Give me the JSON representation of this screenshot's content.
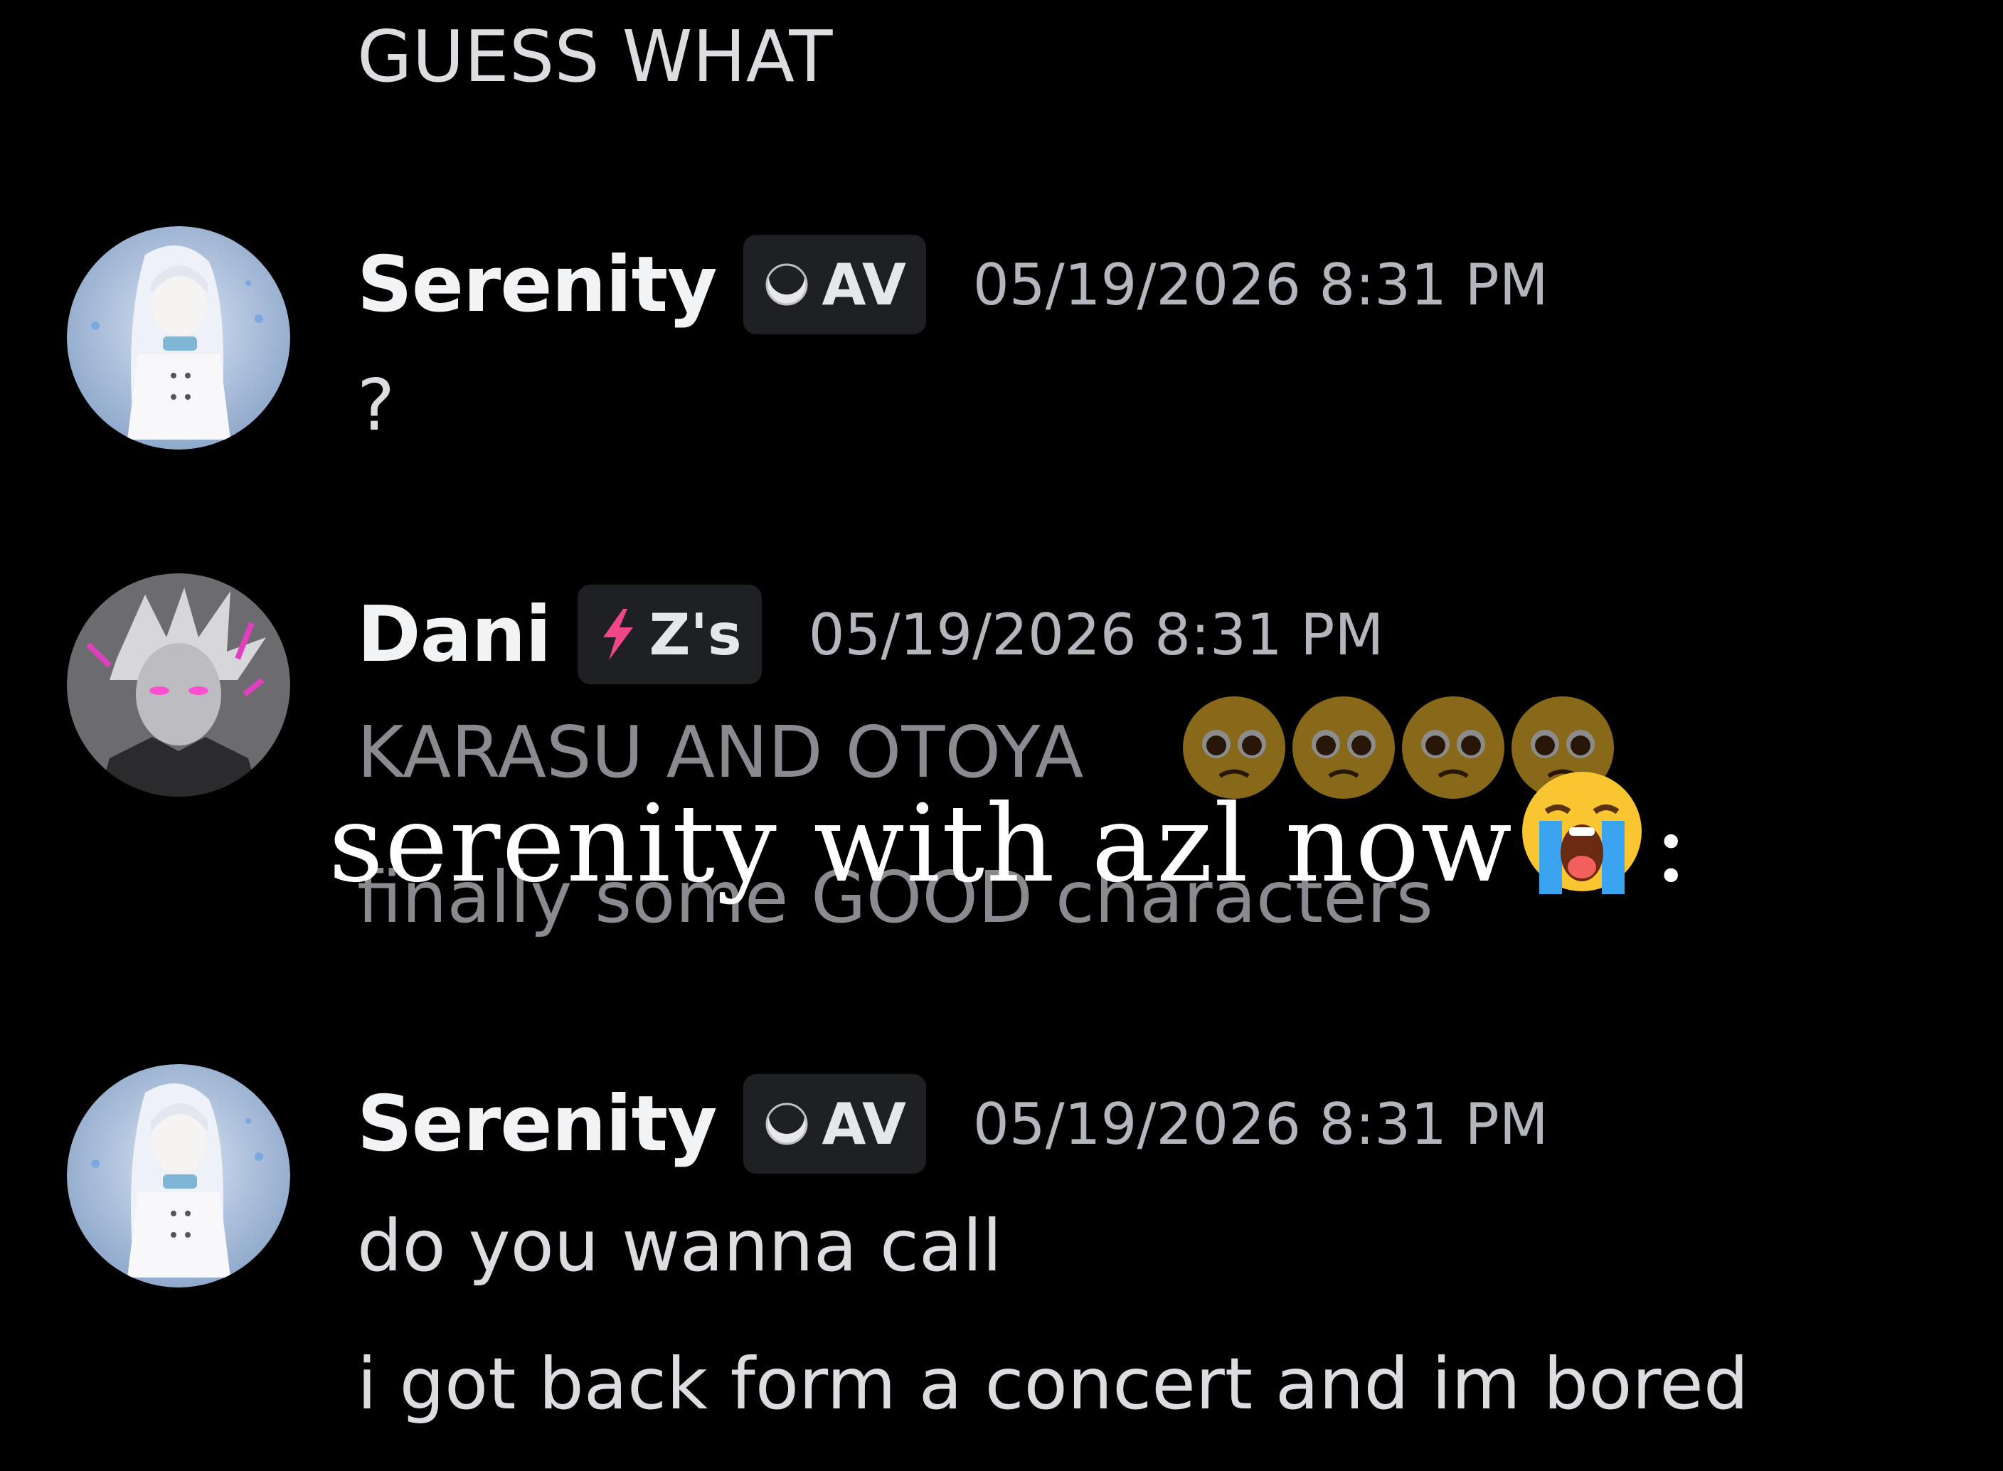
{
  "messages": {
    "top_continuation": {
      "text": "GUESS WHAT"
    },
    "msg1": {
      "username": "Serenity",
      "tag": "AV",
      "tag_icon": "moon-crescent-icon",
      "timestamp": "05/19/2026 8:31 PM",
      "lines": [
        "?"
      ]
    },
    "msg2": {
      "username": "Dani",
      "tag": "Z's",
      "tag_icon": "lightning-bolt-icon",
      "timestamp": "05/19/2026 8:31 PM",
      "lines": [
        "KARASU AND OTOYA",
        "finally some GOOD characters"
      ],
      "emojis": [
        "pleading-face-emoji",
        "pleading-face-emoji",
        "pleading-face-emoji",
        "pleading-face-emoji"
      ]
    },
    "msg3": {
      "username": "Serenity",
      "tag": "AV",
      "tag_icon": "moon-crescent-icon",
      "timestamp": "05/19/2026 8:31 PM",
      "lines": [
        "do you wanna call",
        "i got back form a concert and im bored"
      ]
    }
  },
  "overlay": {
    "caption": "serenity with azl now",
    "emoji": "loudly-crying-face-emoji",
    "suffix": ":"
  },
  "colors": {
    "background": "#000000",
    "username": "#f2f3f5",
    "timestamp": "#b3b6bd",
    "tag_bg": "#1f2023",
    "lightning": "#f0478a"
  }
}
